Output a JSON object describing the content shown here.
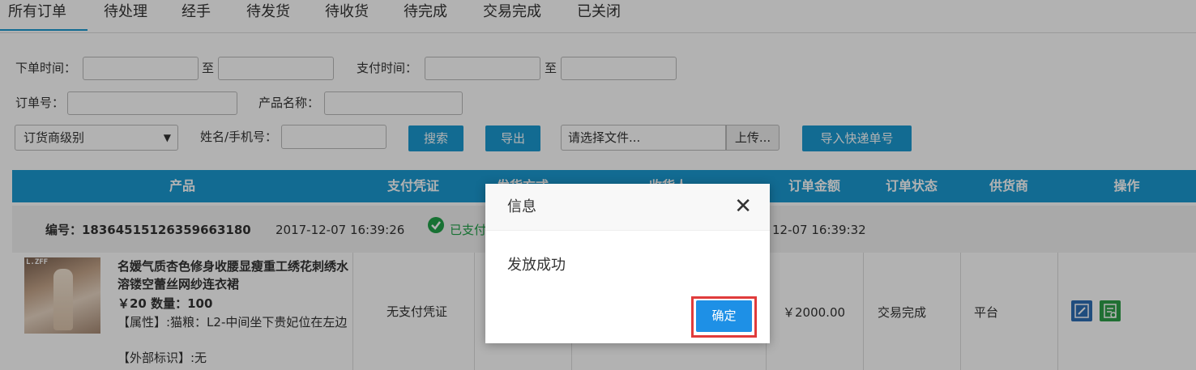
{
  "tabs": [
    "所有订单",
    "待处理",
    "经手",
    "待发货",
    "待收货",
    "待完成",
    "交易完成",
    "已关闭"
  ],
  "filters": {
    "order_time_label": "下单时间：",
    "to_label": "至",
    "pay_time_label": "支付时间：",
    "order_no_label": "订单号：",
    "product_name_label": "产品名称：",
    "dealer_level": "订货商级别",
    "name_phone_label": "姓名/手机号：",
    "search_button": "搜索",
    "export_button": "导出",
    "file_placeholder": "请选择文件...",
    "upload_button": "上传...",
    "import_button": "导入快递单号"
  },
  "table": {
    "headers": [
      "产品",
      "支付凭证",
      "发货方式",
      "收货人",
      "订单金额",
      "订单状态",
      "供货商",
      "操作"
    ]
  },
  "order": {
    "number_label": "编号：1836451512635966318​0",
    "order_time": "2017-12-07 16:39:26",
    "pay_status": "已支付",
    "pay_time": "12-07 16:39:32",
    "product_brand_tag": "L.ZFF",
    "product_title": "名媛气质杏色修身收腰显瘦重工绣花刺绣水溶镂空蕾丝网纱连衣裙",
    "price_qty": "￥20 数量：100",
    "attrs": "【属性】:猫粮：L2-中间坐下贵妃位在左边",
    "external_id": "【外部标识】:无",
    "payment_proof": "无支付凭证",
    "amount": "￥2000.00",
    "status": "交易完成",
    "supplier": "平台"
  },
  "dialog": {
    "title": "信息",
    "message": "发放成功",
    "ok_button": "确定"
  },
  "colors": {
    "accent": "#1a9ad1",
    "dialog_button": "#1e90e6",
    "highlight": "#e03b3b",
    "paid_green": "#22a34a"
  }
}
